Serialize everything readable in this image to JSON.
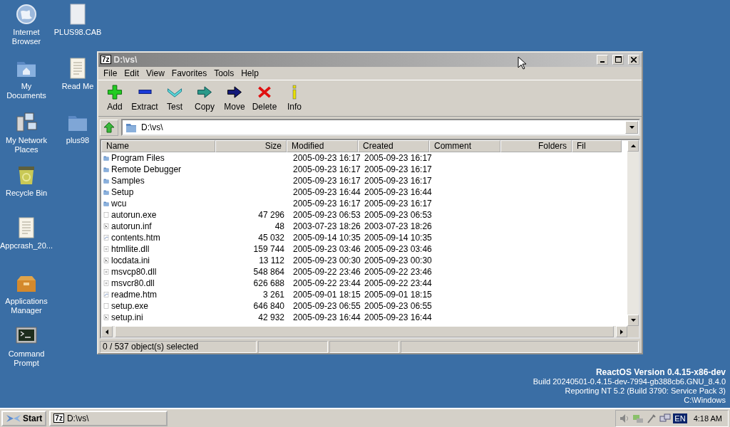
{
  "desktop_icons": [
    {
      "label": "Internet Browser",
      "kind": "globe"
    },
    {
      "label": "My Documents",
      "kind": "documents"
    },
    {
      "label": "My Network Places",
      "kind": "network"
    },
    {
      "label": "Recycle Bin",
      "kind": "recycle"
    },
    {
      "label": "Appcrash_20...",
      "kind": "text"
    },
    {
      "label": "Applications Manager",
      "kind": "package"
    },
    {
      "label": "Command Prompt",
      "kind": "console"
    },
    {
      "label": "PLUS98.CAB",
      "kind": "file"
    },
    {
      "label": "Read Me",
      "kind": "text"
    },
    {
      "label": "plus98",
      "kind": "folder"
    }
  ],
  "window": {
    "app_icon": "7z",
    "title": "D:\\vs\\",
    "active": false,
    "menu": [
      "File",
      "Edit",
      "View",
      "Favorites",
      "Tools",
      "Help"
    ],
    "toolbar": [
      {
        "label": "Add",
        "kind": "add"
      },
      {
        "label": "Extract",
        "kind": "extract"
      },
      {
        "label": "Test",
        "kind": "test"
      },
      {
        "label": "Copy",
        "kind": "copy"
      },
      {
        "label": "Move",
        "kind": "move"
      },
      {
        "label": "Delete",
        "kind": "delete"
      },
      {
        "label": "Info",
        "kind": "info"
      }
    ],
    "address": {
      "value": "D:\\vs\\"
    },
    "table": {
      "columns": [
        "Name",
        "Size",
        "Modified",
        "Created",
        "Comment",
        "Folders",
        "Fil"
      ],
      "rows": [
        {
          "kind": "folder",
          "name": "Program Files",
          "size": "",
          "modified": "2005-09-23 16:17",
          "created": "2005-09-23 16:17"
        },
        {
          "kind": "folder",
          "name": "Remote Debugger",
          "size": "",
          "modified": "2005-09-23 16:17",
          "created": "2005-09-23 16:17"
        },
        {
          "kind": "folder",
          "name": "Samples",
          "size": "",
          "modified": "2005-09-23 16:17",
          "created": "2005-09-23 16:17"
        },
        {
          "kind": "folder",
          "name": "Setup",
          "size": "",
          "modified": "2005-09-23 16:44",
          "created": "2005-09-23 16:44"
        },
        {
          "kind": "folder",
          "name": "wcu",
          "size": "",
          "modified": "2005-09-23 16:17",
          "created": "2005-09-23 16:17"
        },
        {
          "kind": "exe",
          "name": "autorun.exe",
          "size": "47 296",
          "modified": "2005-09-23 06:53",
          "created": "2005-09-23 06:53"
        },
        {
          "kind": "ini",
          "name": "autorun.inf",
          "size": "48",
          "modified": "2003-07-23 18:26",
          "created": "2003-07-23 18:26"
        },
        {
          "kind": "htm",
          "name": "contents.htm",
          "size": "45 032",
          "modified": "2005-09-14 10:35",
          "created": "2005-09-14 10:35"
        },
        {
          "kind": "dll",
          "name": "htmllite.dll",
          "size": "159 744",
          "modified": "2005-09-23 03:46",
          "created": "2005-09-23 03:46"
        },
        {
          "kind": "ini",
          "name": "locdata.ini",
          "size": "13 112",
          "modified": "2005-09-23 00:30",
          "created": "2005-09-23 00:30"
        },
        {
          "kind": "dll",
          "name": "msvcp80.dll",
          "size": "548 864",
          "modified": "2005-09-22 23:46",
          "created": "2005-09-22 23:46"
        },
        {
          "kind": "dll",
          "name": "msvcr80.dll",
          "size": "626 688",
          "modified": "2005-09-22 23:44",
          "created": "2005-09-22 23:44"
        },
        {
          "kind": "htm",
          "name": "readme.htm",
          "size": "3 261",
          "modified": "2005-09-01 18:15",
          "created": "2005-09-01 18:15"
        },
        {
          "kind": "exe",
          "name": "setup.exe",
          "size": "646 840",
          "modified": "2005-09-23 06:55",
          "created": "2005-09-23 06:55"
        },
        {
          "kind": "ini",
          "name": "setup.ini",
          "size": "42 932",
          "modified": "2005-09-23 16:44",
          "created": "2005-09-23 16:44"
        }
      ]
    },
    "status_bar": [
      "0 / 537 object(s) selected"
    ]
  },
  "version_info": {
    "title": "ReactOS Version 0.4.15-x86-dev",
    "lines": [
      "Build 20240501-0.4.15-dev-7994-gb388cb6.GNU_8.4.0",
      "Reporting NT 5.2 (Build 3790: Service Pack 3)",
      "C:\\Windows"
    ]
  },
  "taskbar": {
    "start": "Start",
    "tasks": [
      {
        "icon": "7z",
        "label": "D:\\vs\\"
      }
    ],
    "language": "EN",
    "clock": "4:18 AM"
  }
}
